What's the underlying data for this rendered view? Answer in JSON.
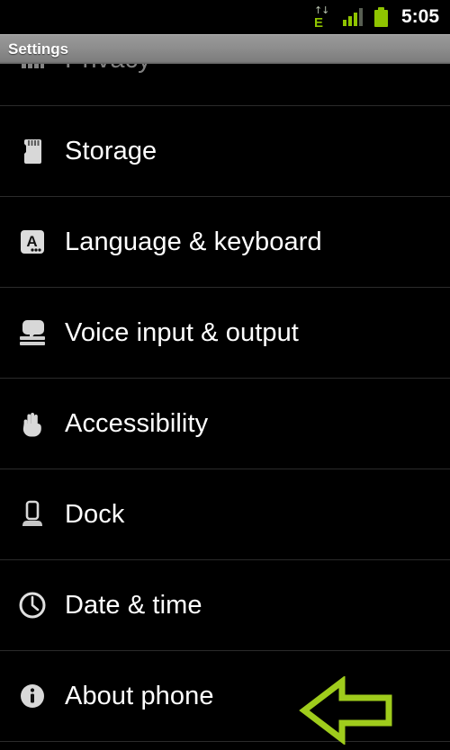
{
  "status_bar": {
    "data_icon": "edge-data-icon",
    "data_label": "E",
    "data_arrows": "↑↓",
    "signal_icon": "signal-bars-icon",
    "signal_bars_filled": 3,
    "signal_bars_total": 4,
    "battery_icon": "battery-full-icon",
    "time": "5:05",
    "accent_green": "#8fc400"
  },
  "title_bar": {
    "title": "Settings"
  },
  "list": {
    "partial_top_item": {
      "label": "Privacy",
      "icon": "privacy-icon"
    },
    "items": [
      {
        "label": "Storage",
        "icon": "sd-card-icon"
      },
      {
        "label": "Language & keyboard",
        "icon": "keyboard-key-a-icon"
      },
      {
        "label": "Voice input & output",
        "icon": "speech-bubble-icon"
      },
      {
        "label": "Accessibility",
        "icon": "hand-icon"
      },
      {
        "label": "Dock",
        "icon": "phone-dock-icon"
      },
      {
        "label": "Date & time",
        "icon": "clock-icon"
      },
      {
        "label": "About phone",
        "icon": "info-circle-icon"
      }
    ]
  },
  "annotation": {
    "arrow": {
      "name": "left-pointing-arrow-annotation",
      "direction": "left",
      "color": "#9fcc1c",
      "points_to": "About phone"
    }
  }
}
